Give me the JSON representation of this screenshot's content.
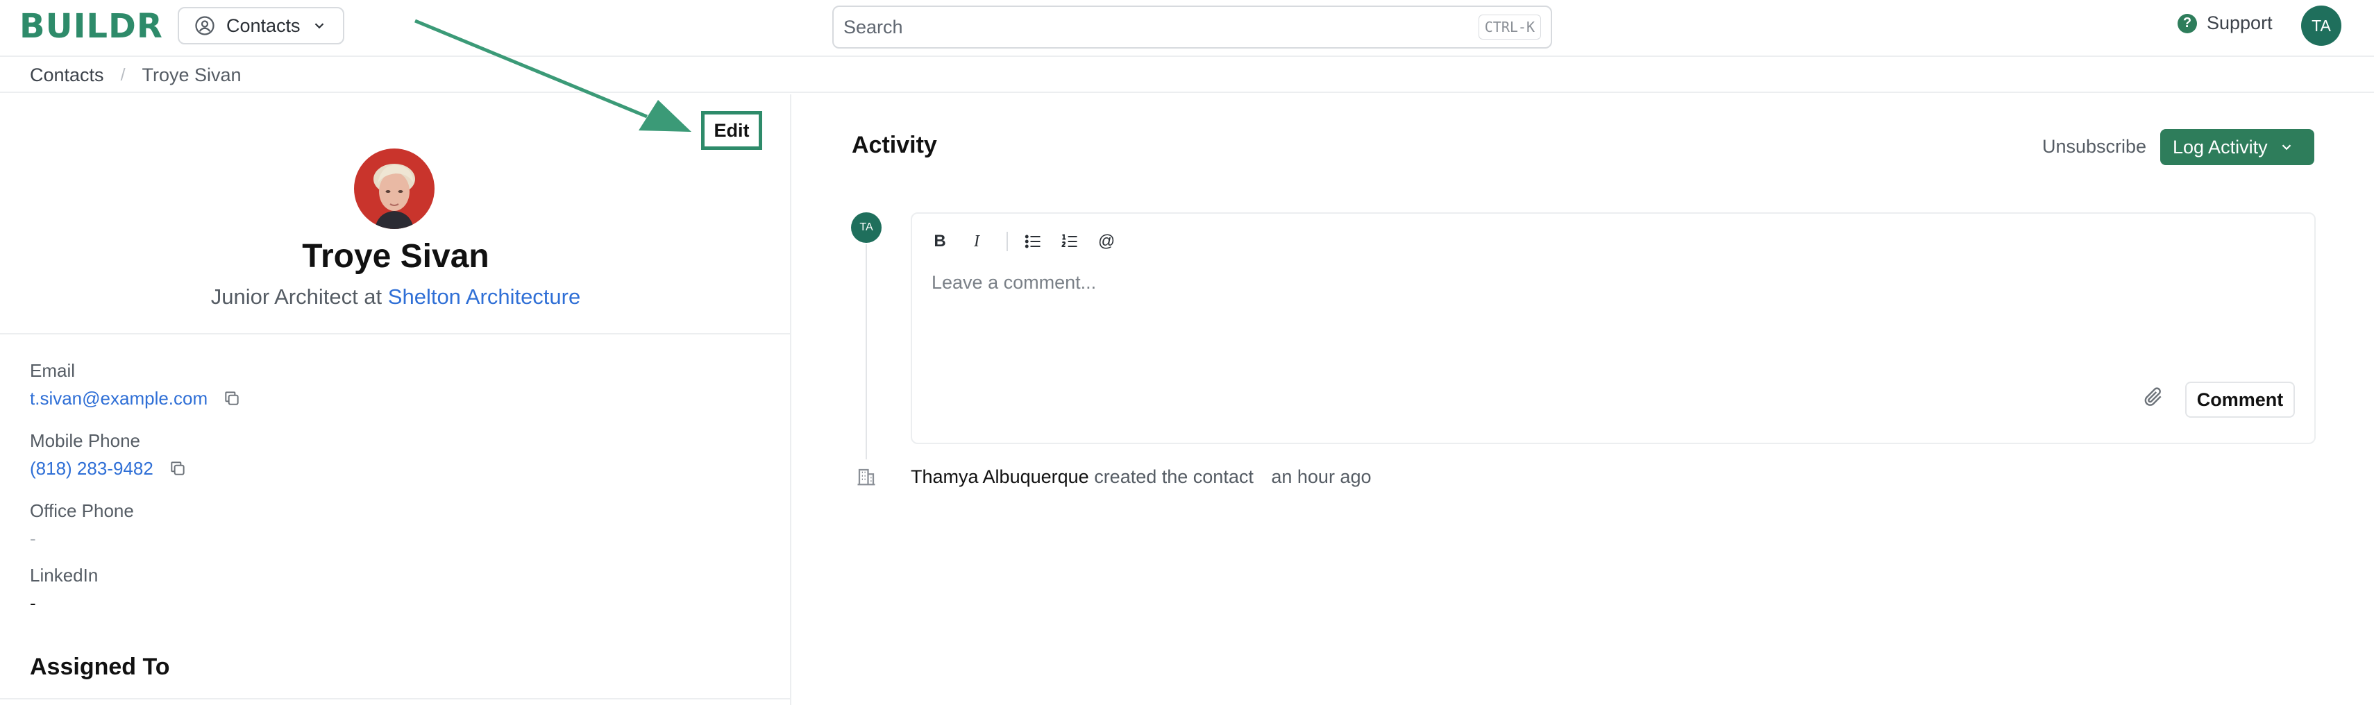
{
  "app": {
    "logo": "BUILDR",
    "brand_color": "#2e8b6a",
    "switcher_label": "Contacts",
    "switcher_icon": "contact-circle-icon",
    "search_placeholder": "Search",
    "search_shortcut": "CTRL-K",
    "support_label": "Support",
    "user_initials": "TA"
  },
  "breadcrumb": {
    "parent": "Contacts",
    "separator": "/",
    "current": "Troye Sivan"
  },
  "contact": {
    "edit_label": "Edit",
    "name": "Troye Sivan",
    "job_prefix": "Junior Architect at ",
    "company": "Shelton Architecture",
    "fields": {
      "email": {
        "label": "Email",
        "value": "t.sivan@example.com"
      },
      "mobile": {
        "label": "Mobile Phone",
        "value": "(818) 283-9482"
      },
      "office": {
        "label": "Office Phone",
        "value": "-"
      },
      "linkedin": {
        "label": "LinkedIn",
        "value": "-"
      }
    },
    "assigned_title": "Assigned To"
  },
  "activity": {
    "title": "Activity",
    "unsubscribe_label": "Unsubscribe",
    "log_label": "Log Activity",
    "avatar_initials": "TA",
    "editor": {
      "toolbar": [
        "bold",
        "italic",
        "bullet-list",
        "numbered-list",
        "mention"
      ],
      "bold_glyph": "B",
      "italic_glyph": "I",
      "mention_glyph": "@",
      "placeholder": "Leave a comment...",
      "submit_label": "Comment"
    },
    "events": [
      {
        "actor": "Thamya Albuquerque",
        "action": "created the contact",
        "time": "an hour ago"
      }
    ]
  }
}
